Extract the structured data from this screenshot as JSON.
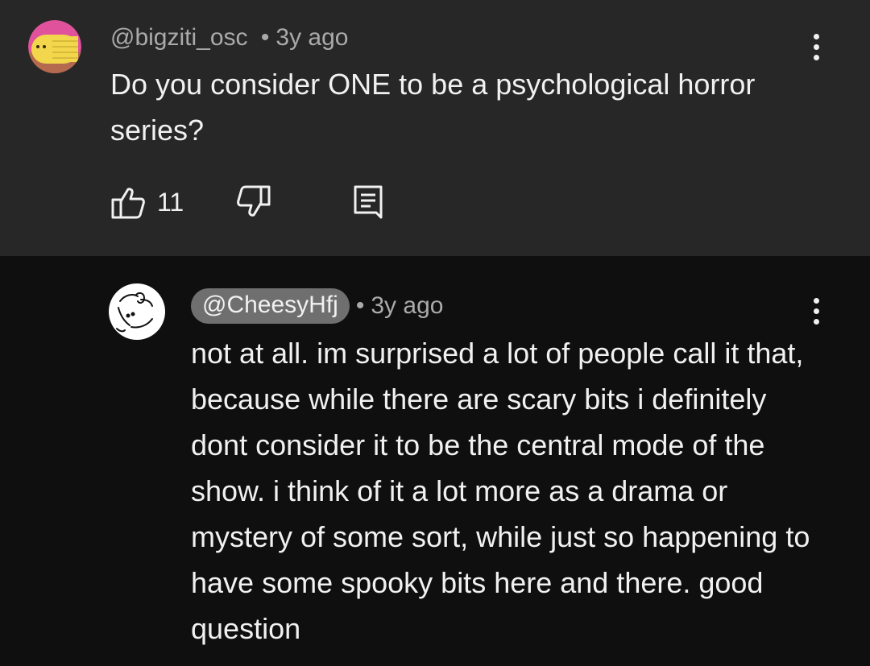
{
  "top_comment": {
    "handle": "@bigziti_osc",
    "separator": "•",
    "timestamp": "3y ago",
    "text": "Do you consider ONE to be a psychological horror series?",
    "like_count": "11",
    "icons": {
      "avatar": "avatar-icon",
      "menu": "more-vert-icon",
      "like": "thumbs-up-icon",
      "dislike": "thumbs-down-icon",
      "reply": "reply-icon"
    },
    "colors": {
      "background": "#272727",
      "avatar_ring": "#e0529c",
      "avatar_fill": "#f2d64b"
    }
  },
  "reply_comment": {
    "handle": "@CheesyHfj",
    "separator": "•",
    "timestamp": "3y ago",
    "text": "not at all. im surprised a lot of people call it that, because while there are scary bits i definitely dont consider it to be the central mode of the show. i think of it a lot more as a drama or mystery of some sort, while just so happening to have some spooky bits here and there. good question",
    "icons": {
      "avatar": "avatar-icon",
      "menu": "more-vert-icon"
    },
    "colors": {
      "background": "#0f0f0f",
      "handle_chip": "#6f6f6f"
    }
  }
}
